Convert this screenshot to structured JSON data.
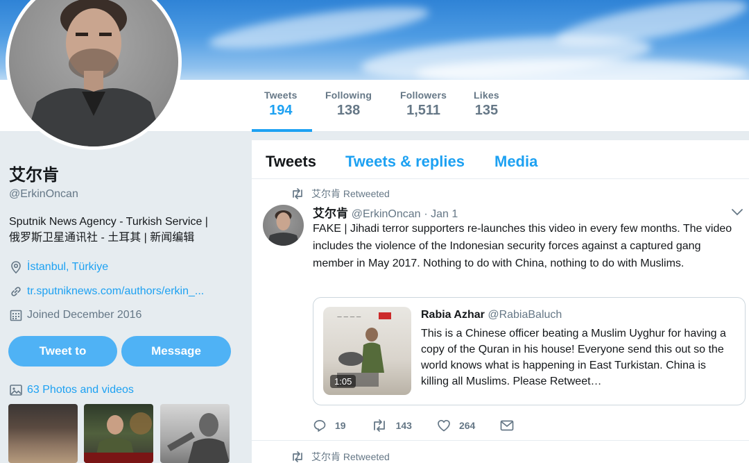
{
  "header": {
    "stats": [
      {
        "label": "Tweets",
        "value": "194"
      },
      {
        "label": "Following",
        "value": "138"
      },
      {
        "label": "Followers",
        "value": "1,511"
      },
      {
        "label": "Likes",
        "value": "135"
      }
    ]
  },
  "profile": {
    "name": "艾尔肯",
    "handle": "@ErkinOncan",
    "bio_line1": "Sputnik News Agency - Turkish Service |",
    "bio_line2": "俄罗斯卫星通讯社 - 土耳其 | 新闻编辑",
    "location": "İstanbul, Türkiye",
    "website": "tr.sputniknews.com/authors/erkin_...",
    "joined": "Joined December 2016",
    "tweet_to_label": "Tweet to",
    "message_label": "Message",
    "photos_label": "63 Photos and videos"
  },
  "timeline": {
    "tabs": [
      "Tweets",
      "Tweets & replies",
      "Media"
    ],
    "tweet": {
      "retweeted_by": "艾尔肯 Retweeted",
      "author_name": "艾尔肯",
      "author_handle": "@ErkinOncan",
      "date": "· Jan 1",
      "text": "FAKE | Jihadi terror supporters re-launches this video in every few months. The video includes the violence of the Indonesian security forces against a captured gang member in May 2017. Nothing to do with China, nothing to do with Muslims.",
      "quote": {
        "author_name": "Rabia Azhar",
        "author_handle": "@RabiaBaluch",
        "text": "This is a Chinese officer beating a Muslim Uyghur for having a copy of the Quran in his house! Everyone send this out so the world knows what is happening in East Turkistan. China is killing all Muslims. Please Retweet…",
        "video_duration": "1:05"
      },
      "replies": "19",
      "retweets": "143",
      "likes": "264"
    },
    "next_retweeted_by": "艾尔肯 Retweeted"
  },
  "colors": {
    "accent": "#1da1f2",
    "button": "#4fb2f5",
    "muted": "#657786"
  }
}
